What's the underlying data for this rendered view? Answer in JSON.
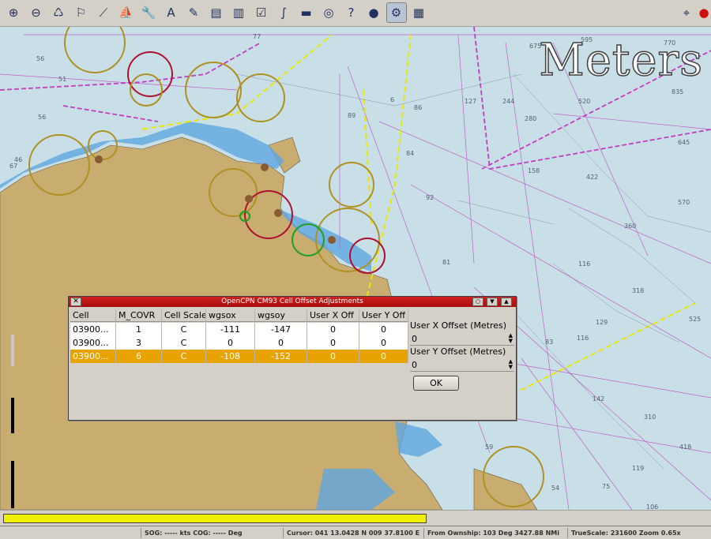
{
  "toolbar": {
    "buttons": [
      {
        "name": "zoom-in-button",
        "icon": "zoom-in-icon"
      },
      {
        "name": "zoom-out-button",
        "icon": "zoom-out-icon"
      },
      {
        "name": "scale-in-button",
        "icon": "scale-in-icon"
      },
      {
        "name": "scale-out-button",
        "icon": "scale-out-icon"
      },
      {
        "name": "route-button",
        "icon": "route-icon"
      },
      {
        "name": "auto-follow-button",
        "icon": "ship-icon"
      },
      {
        "name": "settings-button",
        "icon": "wrench-icon"
      },
      {
        "name": "text-button",
        "icon": "text-icon"
      },
      {
        "name": "current-button",
        "icon": "pencil-icon"
      },
      {
        "name": "chart-quilt-button",
        "icon": "layers-icon"
      },
      {
        "name": "tide-button",
        "icon": "tide-icon"
      },
      {
        "name": "route-manager-button",
        "icon": "checklist-icon"
      },
      {
        "name": "track-button",
        "icon": "track-icon"
      },
      {
        "name": "color-scheme-button",
        "icon": "color-scheme-icon"
      },
      {
        "name": "mob-button",
        "icon": "lifebuoy-icon"
      },
      {
        "name": "help-button",
        "icon": "help-icon"
      },
      {
        "name": "globe-button",
        "icon": "globe-icon"
      },
      {
        "name": "plugin-button",
        "icon": "plugin-icon"
      },
      {
        "name": "dashboard-button",
        "icon": "dashboard-icon"
      }
    ],
    "compass_icon": "compass-icon"
  },
  "chart": {
    "units_label": "Meters",
    "depths": [
      "595",
      "770",
      "835",
      "675",
      "127",
      "244",
      "280",
      "86",
      "520",
      "645",
      "56",
      "89",
      "84",
      "158",
      "422",
      "92",
      "570",
      "81",
      "360",
      "318",
      "116",
      "129",
      "525",
      "83",
      "116",
      "142",
      "310",
      "418",
      "59",
      "119",
      "54",
      "75",
      "106",
      "77",
      "56",
      "51",
      "46",
      "67",
      "6"
    ]
  },
  "dialog": {
    "title": "OpenCPN CM93 Cell Offset Adjustments",
    "columns": [
      "Cell",
      "M_COVR",
      "Cell Scale",
      "wgsox",
      "wgsoy",
      "User X Off",
      "User Y Off"
    ],
    "rows": [
      [
        "03900...",
        "1",
        "C",
        "-111",
        "-147",
        "0",
        "0"
      ],
      [
        "03900...",
        "3",
        "C",
        "0",
        "0",
        "0",
        "0"
      ],
      [
        "03900...",
        "6",
        "C",
        "-108",
        "-152",
        "0",
        "0"
      ]
    ],
    "selected_row": 2,
    "x_offset_label": "User X Offset (Metres)",
    "x_offset_value": "0",
    "y_offset_label": "User Y Offset (Metres)",
    "y_offset_value": "0",
    "ok_label": "OK"
  },
  "progress": {
    "fraction": 0.6
  },
  "status": {
    "sog": "SOG: ----- kts  COG: ----- Deg",
    "cursor": "Cursor: 041 13.0428 N 009 37.8100 E",
    "ownship": "From Ownship: 103 Deg  3427.88 NMi",
    "scale": "TrueScale:   231600  Zoom 0.65x"
  },
  "colors": {
    "land": "#c9ac70",
    "shallow": "#5fa6df",
    "sea": "#c8dfe8",
    "selection": "#e8a300",
    "title": "#b01010"
  }
}
